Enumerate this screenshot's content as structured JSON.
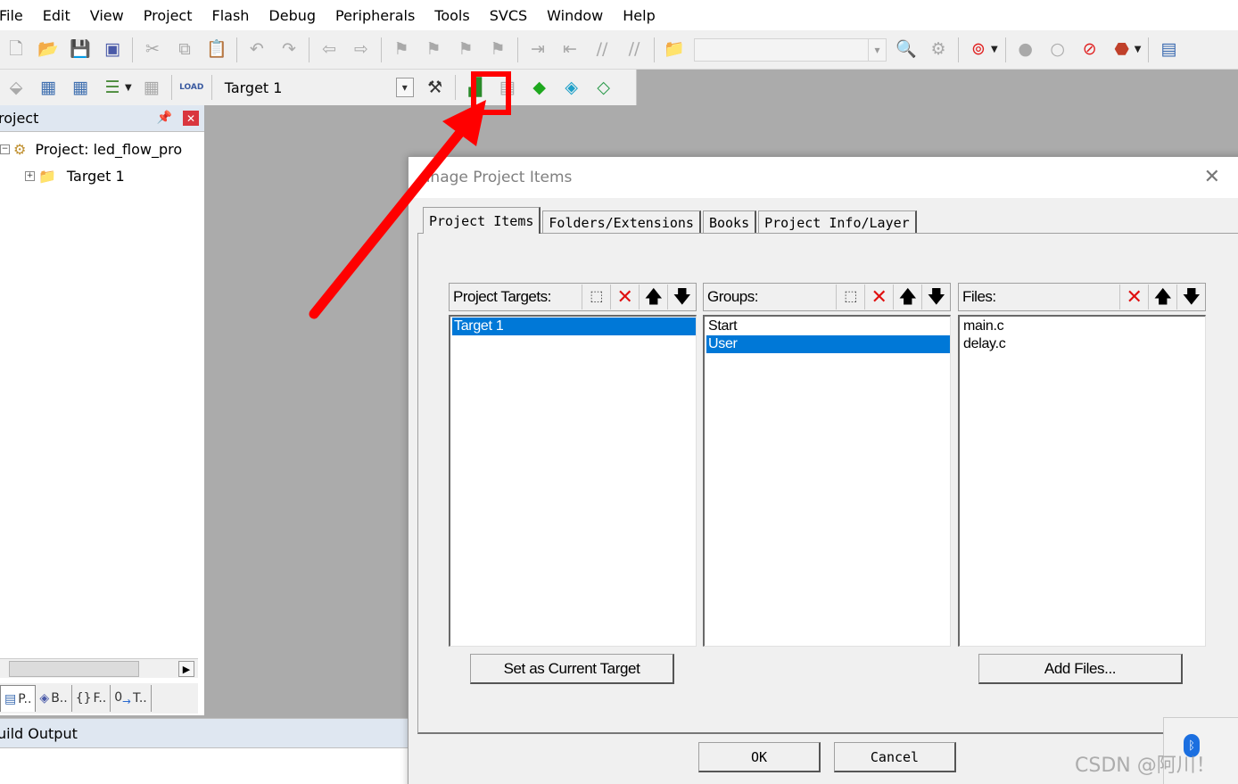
{
  "menu": [
    "File",
    "Edit",
    "View",
    "Project",
    "Flash",
    "Debug",
    "Peripherals",
    "Tools",
    "SVCS",
    "Window",
    "Help"
  ],
  "toolbar2": {
    "target": "Target 1",
    "load_icon_label": "LOAD"
  },
  "project_pane": {
    "title": "roject",
    "tree": [
      {
        "label": "Project: led_flow_pro"
      },
      {
        "label": "Target 1"
      }
    ],
    "tabs": [
      "P..",
      "B..",
      "F..",
      "T.."
    ]
  },
  "build_output": {
    "title": "uild Output"
  },
  "dialog": {
    "title": "anage Project Items",
    "tabs": [
      "Project Items",
      "Folders/Extensions",
      "Books",
      "Project Info/Layer"
    ],
    "groups": [
      {
        "label": "Project Targets:",
        "items": [
          {
            "text": "Target 1",
            "selected": true
          }
        ]
      },
      {
        "label": "Groups:",
        "items": [
          {
            "text": "Start",
            "selected": false
          },
          {
            "text": "User",
            "selected": true
          }
        ]
      },
      {
        "label": "Files:",
        "items": [
          {
            "text": "main.c",
            "selected": false
          },
          {
            "text": "delay.c",
            "selected": false
          }
        ]
      }
    ],
    "set_current_label": "Set as Current Target",
    "add_files_label": "Add Files...",
    "ok_label": "OK",
    "cancel_label": "Cancel"
  },
  "watermark": "CSDN @阿川！",
  "colors": {
    "highlight": "#ff0000",
    "selection": "#0078d7"
  }
}
